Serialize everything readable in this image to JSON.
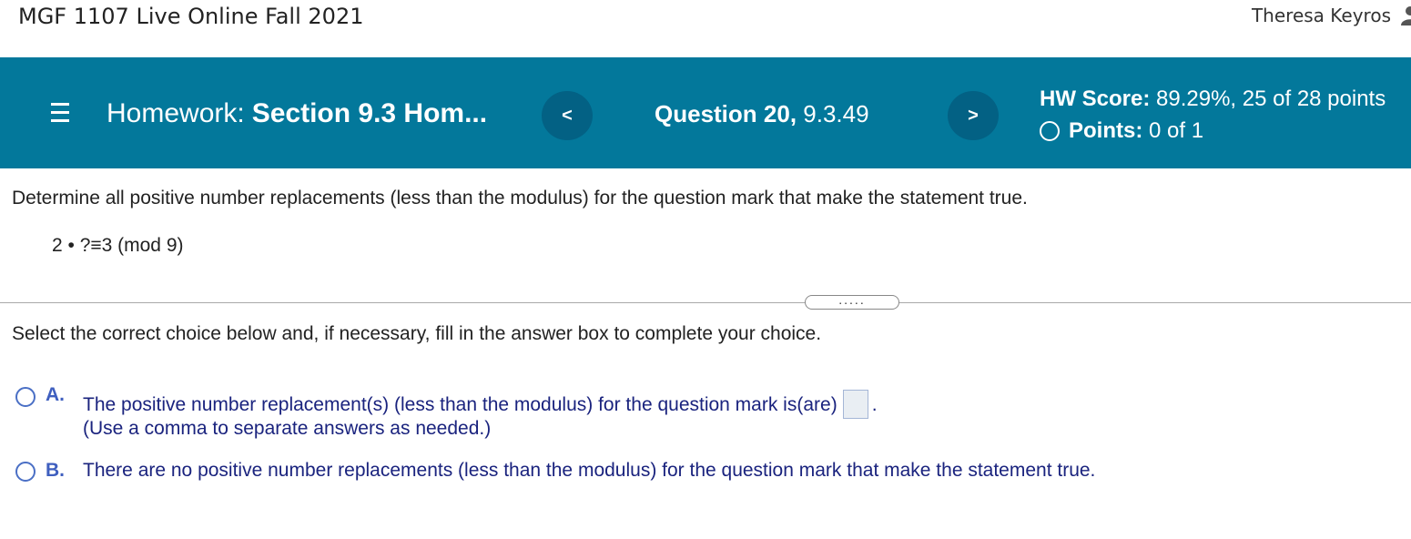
{
  "header": {
    "course_title": "MGF 1107 Live Online Fall 2021",
    "user_name": "Theresa Keyros"
  },
  "homework_bar": {
    "homework_prefix": "Homework:",
    "homework_name": "Section 9.3 Hom...",
    "prev_label": "<",
    "next_label": ">",
    "question_label": "Question 20,",
    "question_id": "9.3.49",
    "hw_score_label": "HW Score:",
    "hw_score_value": "89.29%, 25 of 28 points",
    "points_label": "Points:",
    "points_value": "0 of 1",
    "bar_color": "#03789b"
  },
  "question": {
    "text": "Determine all positive number replacements (less than the modulus) for the question mark that make the statement true.",
    "equation": "2 • ?≡3 (mod 9)"
  },
  "divider": {
    "expand_label": "....."
  },
  "answer_section": {
    "instructions": "Select the correct choice below and, if necessary, fill in the answer box to complete your choice.",
    "choices": [
      {
        "letter": "A.",
        "text": "The positive number replacement(s) (less than the modulus) for the question mark is(are)",
        "after_box": ".",
        "hint": "(Use a comma to separate answers as needed.)",
        "answer_value": ""
      },
      {
        "letter": "B.",
        "text": "There are no positive number replacements (less than the modulus) for the question mark that make the statement true."
      }
    ]
  }
}
